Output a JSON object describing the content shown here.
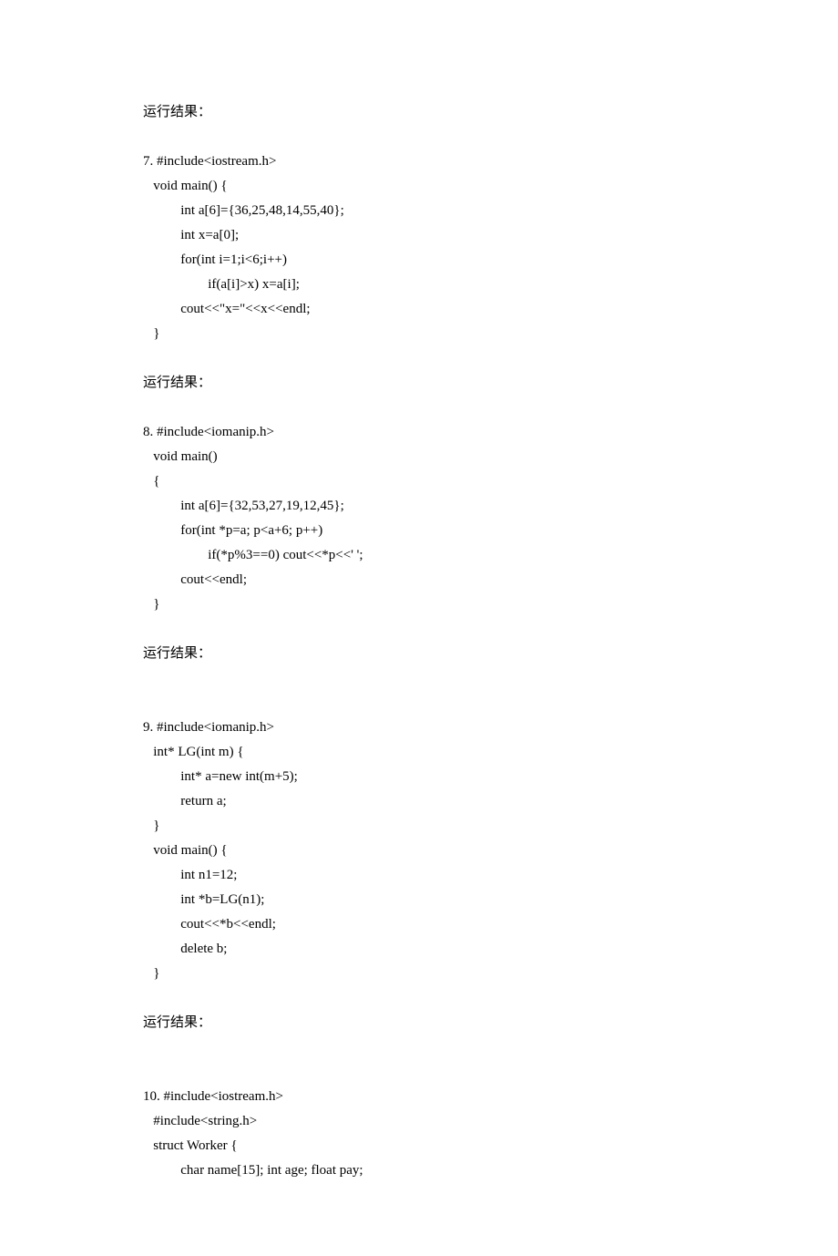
{
  "doc": {
    "label_result": "运行结果：",
    "snippets": [
      {
        "num": "7.",
        "lines": [
          "#include<iostream.h>",
          "void main() {",
          "    int a[6]={36,25,48,14,55,40};",
          "    int x=a[0];",
          "    for(int i=1;i<6;i++)",
          "        if(a[i]>x) x=a[i];",
          "    cout<<\"x=\"<<x<<endl;",
          "}"
        ]
      },
      {
        "num": "8.",
        "lines": [
          "#include<iomanip.h>",
          "void main()",
          "{",
          "    int a[6]={32,53,27,19,12,45};",
          "    for(int *p=a; p<a+6; p++)",
          "        if(*p%3==0) cout<<*p<<' ';",
          "    cout<<endl;",
          "}"
        ]
      },
      {
        "num": "9.",
        "lines": [
          "#include<iomanip.h>",
          "int* LG(int m) {",
          "    int* a=new int(m+5);",
          "    return a;",
          "}",
          "void main() {",
          "    int n1=12;",
          "    int *b=LG(n1);",
          "    cout<<*b<<endl;",
          "    delete b;",
          "}"
        ]
      },
      {
        "num": "10.",
        "lines": [
          "#include<iostream.h>",
          "#include<string.h>",
          "struct Worker {",
          "    char name[15]; int age; float pay;"
        ]
      }
    ]
  }
}
